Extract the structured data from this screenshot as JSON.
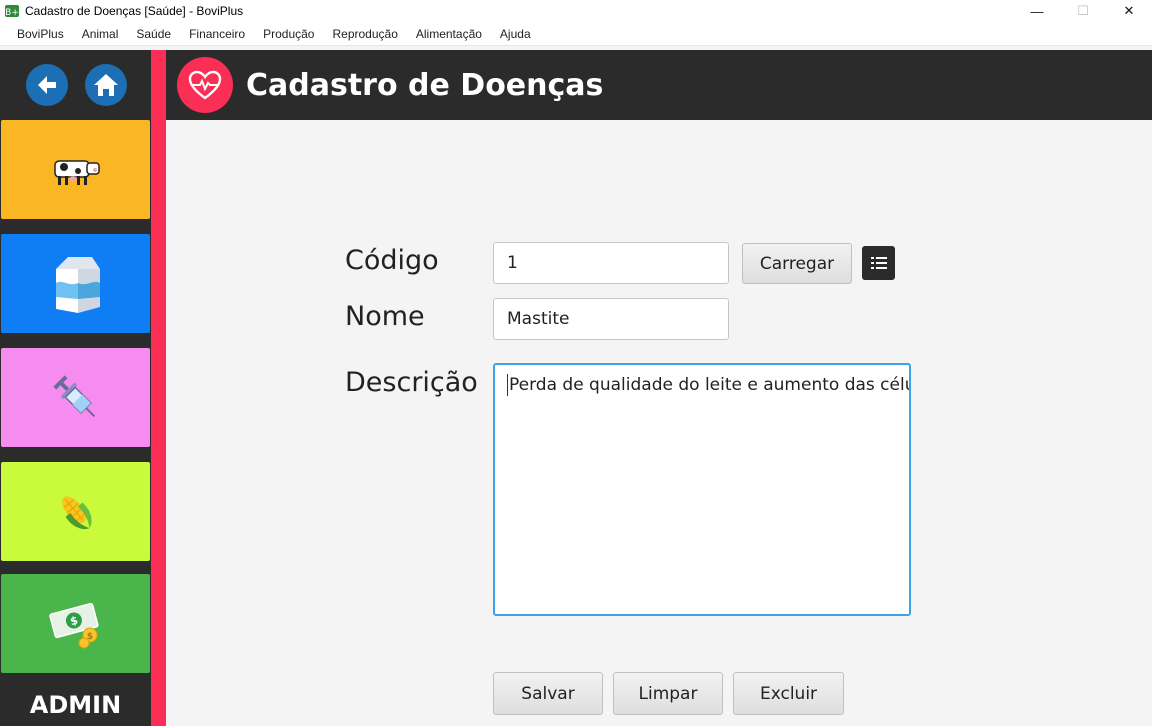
{
  "window": {
    "title": "Cadastro de Doenças [Saúde] - BoviPlus",
    "controls": {
      "minimize": "—",
      "maximize": "☐",
      "close": "✕"
    }
  },
  "menu": [
    "BoviPlus",
    "Animal",
    "Saúde",
    "Financeiro",
    "Produção",
    "Reprodução",
    "Alimentação",
    "Ajuda"
  ],
  "sidebar": {
    "back_icon": "arrow-left-icon",
    "home_icon": "home-icon",
    "tiles": [
      {
        "icon": "cow-icon",
        "color": "#fbb624"
      },
      {
        "icon": "milk-carton-icon",
        "color": "#0f7df3"
      },
      {
        "icon": "syringe-icon",
        "color": "#f78cf0"
      },
      {
        "icon": "corn-icon",
        "color": "#c9fa3c"
      },
      {
        "icon": "money-icon",
        "color": "#4ab54a"
      }
    ],
    "admin_label": "ADMIN"
  },
  "header": {
    "icon": "heart-pulse-icon",
    "title": "Cadastro de Doenças"
  },
  "form": {
    "codigo_label": "Código",
    "codigo_value": "1",
    "carregar_label": "Carregar",
    "list_icon": "list-icon",
    "nome_label": "Nome",
    "nome_value": "Mastite",
    "descricao_label": "Descrição",
    "descricao_value": "Perda de qualidade do leite e aumento das célu"
  },
  "actions": {
    "salvar": "Salvar",
    "limpar": "Limpar",
    "excluir": "Excluir"
  },
  "colors": {
    "accent_red": "#fb2e56",
    "dark": "#2b2b2b",
    "focus_blue": "#3ca3e6"
  }
}
